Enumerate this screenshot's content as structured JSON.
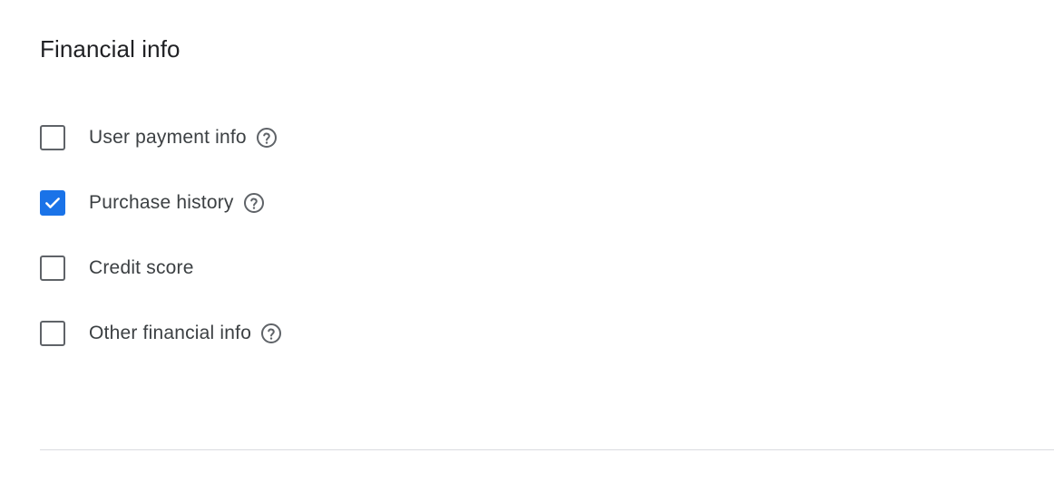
{
  "section": {
    "title": "Financial info"
  },
  "options": [
    {
      "label": "User payment info",
      "checked": false,
      "has_help": true
    },
    {
      "label": "Purchase history",
      "checked": true,
      "has_help": true
    },
    {
      "label": "Credit score",
      "checked": false,
      "has_help": false
    },
    {
      "label": "Other financial info",
      "checked": false,
      "has_help": true
    }
  ],
  "icons": {
    "checkbox_checked": "check-icon",
    "help": "help-circle-icon"
  },
  "colors": {
    "accent": "#1a73e8",
    "checkbox_border": "#5f6368",
    "text": "#3c4043",
    "title": "#202124",
    "divider": "#dadce0"
  }
}
